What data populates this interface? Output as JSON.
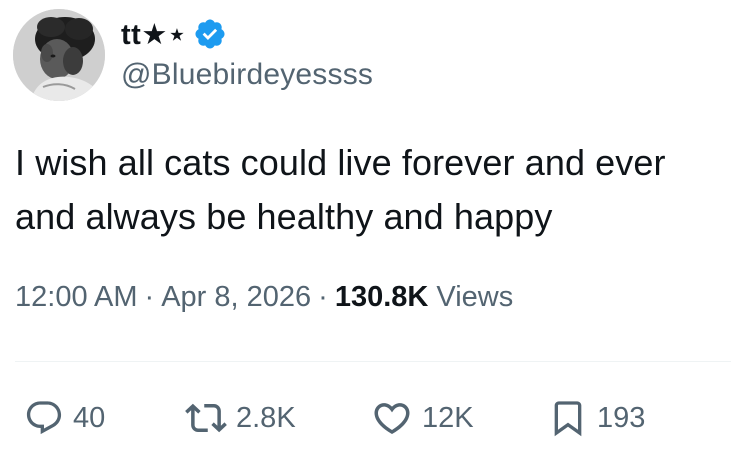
{
  "user": {
    "display_name": "tt★⋆",
    "handle": "@Bluebirdeyessss",
    "verified": true,
    "verified_color": "#1d9bf0"
  },
  "tweet": {
    "text_line1": "I wish all cats could live forever and ever",
    "text_line2": "and always be healthy and happy"
  },
  "meta": {
    "time": "12:00 AM",
    "separator": "·",
    "date": "Apr 8, 2026",
    "views_count": "130.8K",
    "views_label": "Views"
  },
  "actions": {
    "replies": "40",
    "reposts": "2.8K",
    "likes": "12K",
    "bookmarks": "193"
  },
  "icons": {
    "reply": "speech-bubble-icon",
    "repost": "repost-arrows-icon",
    "like": "heart-icon",
    "bookmark": "bookmark-icon",
    "verified": "verified-badge-icon"
  },
  "colors": {
    "text_primary": "#0f1419",
    "text_secondary": "#536471",
    "divider": "#eff3f4"
  }
}
